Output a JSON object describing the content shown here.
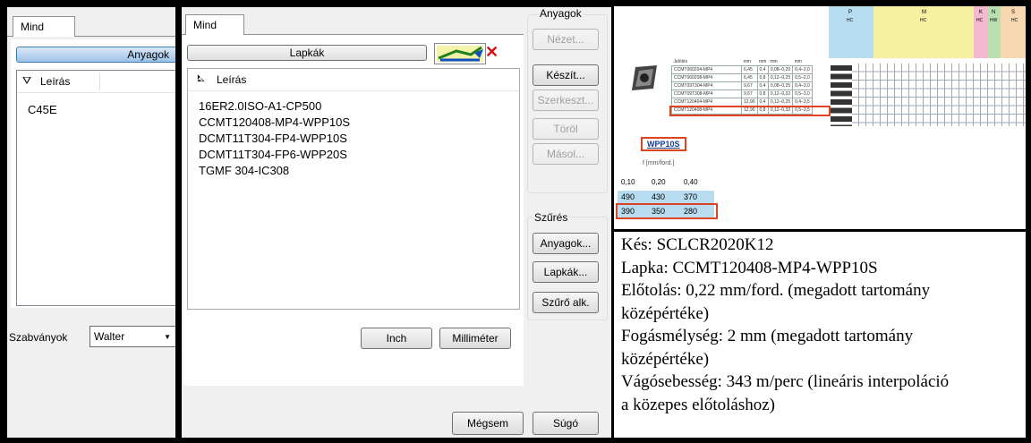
{
  "left_panel": {
    "tab": "Mind",
    "button": "Anyagok",
    "column_header": "Leírás",
    "items": [
      "C45E"
    ],
    "standards_label": "Szabványok",
    "standards_value": "Walter"
  },
  "middle_panel": {
    "tab": "Mind",
    "button": "Lapkák",
    "column_header": "Leírás",
    "items": [
      "16ER2.0ISO-A1-CP500",
      "CCMT120408-MP4-WPP10S",
      "DCMT11T304-FP4-WPP10S",
      "DCMT11T304-FP6-WPP20S",
      "TGMF 304-IC308"
    ],
    "group_label": "Anyagok",
    "buttons": {
      "view": "Nézet...",
      "create": "Készít...",
      "edit": "Szerkeszt...",
      "delete": "Töröl",
      "copy": "Másol..."
    },
    "filter_label": "Szűrés",
    "filter_buttons": {
      "materials": "Anyagok...",
      "inserts": "Lapkák...",
      "settings": "Szűrő alk."
    },
    "units": {
      "inch": "Inch",
      "mm": "Milliméter"
    },
    "cancel": "Mégsem",
    "help": "Súgó"
  },
  "catalog": {
    "grade": "WPP10S",
    "feed_label": "f [mm/ford.]",
    "headers": [
      "0,10",
      "0,20",
      "0,40"
    ],
    "row1": [
      "490",
      "430",
      "370"
    ],
    "row2": [
      "390",
      "350",
      "280"
    ],
    "table_cols": [
      "Jelölés",
      "mm",
      "mm",
      "mm",
      "mm"
    ],
    "table_rows": [
      [
        "CCMT060204-MP4",
        "6,45",
        "0,4",
        "0,08–0,20",
        "0,4–2,0"
      ],
      [
        "CCMT060208-MP4",
        "6,45",
        "0,8",
        "0,12–0,25",
        "0,5–2,0"
      ],
      [
        "CCMT09T304-MP4",
        "9,67",
        "0,4",
        "0,08–0,25",
        "0,4–3,0"
      ],
      [
        "CCMT09T308-MP4",
        "9,67",
        "0,8",
        "0,12–0,32",
        "0,5–3,0"
      ],
      [
        "CCMT120404-MP4",
        "12,90",
        "0,4",
        "0,12–0,25",
        "0,4–3,5"
      ],
      [
        "CCMT120408-MP4",
        "12,90",
        "0,8",
        "0,12–0,32",
        "0,5–3,5"
      ]
    ],
    "group_headers": [
      "P",
      "M",
      "K",
      "N",
      "S"
    ],
    "hc": "HC",
    "hw": "HW",
    "colors": {
      "p": "#b8dcf0",
      "m": "#f6f0a0",
      "k": "#f4b8d0",
      "n": "#b8e0b0",
      "s": "#f8d8b0"
    }
  },
  "notes": [
    "Kés: SCLCR2020K12",
    "Lapka: CCMT120408-MP4-WPP10S",
    "Előtolás: 0,22 mm/ford. (megadott tartomány",
    "középértéke)",
    "Fogásmélység: 2 mm (megadott tartomány",
    "középértéke)",
    "Vágósebesség: 343 m/perc (lineáris interpoláció",
    "a közepes előtoláshoz)"
  ]
}
